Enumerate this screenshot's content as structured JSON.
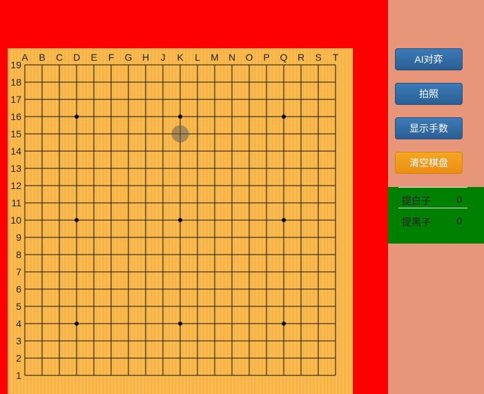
{
  "board": {
    "columns": [
      "A",
      "B",
      "C",
      "D",
      "E",
      "F",
      "G",
      "H",
      "J",
      "K",
      "L",
      "M",
      "N",
      "O",
      "P",
      "Q",
      "R",
      "S",
      "T"
    ],
    "rows": [
      "19",
      "18",
      "17",
      "16",
      "15",
      "14",
      "13",
      "12",
      "11",
      "10",
      "9",
      "8",
      "7",
      "6",
      "5",
      "4",
      "3",
      "2",
      "1"
    ],
    "star_points": [
      "D16",
      "K16",
      "Q16",
      "D10",
      "K10",
      "Q10",
      "D4",
      "K4",
      "Q4"
    ],
    "hover_point": "K15",
    "line_color": "#111111",
    "board_color": "#fbb848"
  },
  "buttons": {
    "ai_label": "AI对弈",
    "photo_label": "拍照",
    "show_moves_label": "显示手数",
    "clear_label": "清空棋盘"
  },
  "captures": {
    "white_label": "提白子",
    "white_count": "0",
    "black_label": "提黑子",
    "black_count": "0"
  },
  "colors": {
    "left_panel": "#ff0000",
    "right_panel": "#e8967a",
    "captures_panel": "#008000",
    "button_blue": "#2f6ca6",
    "button_orange": "#f0a020"
  }
}
